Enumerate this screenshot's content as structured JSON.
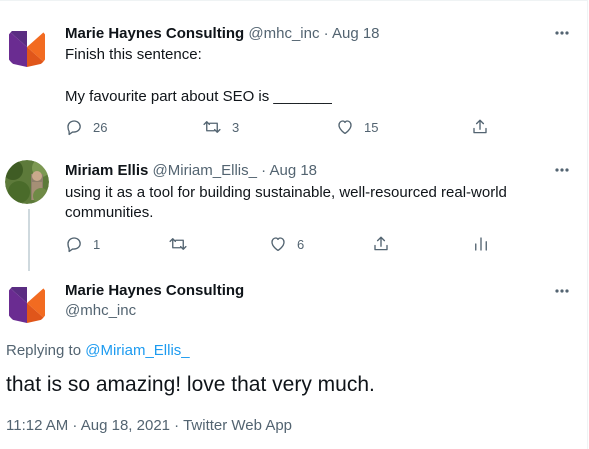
{
  "colors": {
    "accent": "#1d9bf0",
    "text": "#0f1419",
    "muted": "#536471",
    "logo_purple": "#5a2d82",
    "logo_orange": "#f26b21"
  },
  "tweets": [
    {
      "author_name": "Marie Haynes Consulting",
      "handle": "@mhc_inc",
      "separator": "·",
      "date": "Aug 18",
      "lines": [
        "Finish this sentence:",
        "My favourite part about SEO is _______"
      ],
      "actions": {
        "reply_count": "26",
        "retweet_count": "3",
        "like_count": "15"
      }
    },
    {
      "author_name": "Miriam Ellis",
      "handle": "@Miriam_Ellis_",
      "separator": "·",
      "date": "Aug 18",
      "lines": [
        "using it as a tool for building sustainable, well-resourced real-world",
        "communities."
      ],
      "actions": {
        "reply_count": "1",
        "retweet_count": "",
        "like_count": "6"
      }
    }
  ],
  "focused_tweet": {
    "author_name": "Marie Haynes Consulting",
    "handle": "@mhc_inc",
    "replying_prefix": "Replying to",
    "replying_to": "@Miriam_Ellis_",
    "text": "that is so amazing! love that very much.",
    "timestamp": "11:12 AM · Aug 18, 2021 · Twitter Web App"
  },
  "icons": {
    "more": "more-icon",
    "reply": "reply-icon",
    "retweet": "retweet-icon",
    "like": "like-icon",
    "share": "share-icon",
    "analytics": "analytics-icon"
  }
}
